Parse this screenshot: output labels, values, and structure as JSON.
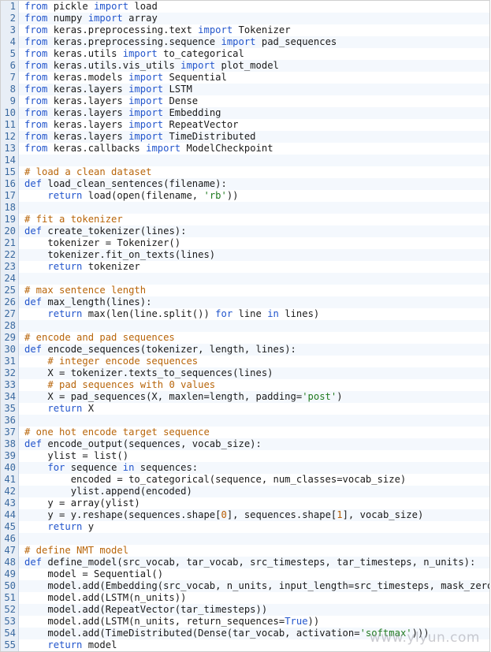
{
  "code": {
    "lines": [
      "from pickle import load",
      "from numpy import array",
      "from keras.preprocessing.text import Tokenizer",
      "from keras.preprocessing.sequence import pad_sequences",
      "from keras.utils import to_categorical",
      "from keras.utils.vis_utils import plot_model",
      "from keras.models import Sequential",
      "from keras.layers import LSTM",
      "from keras.layers import Dense",
      "from keras.layers import Embedding",
      "from keras.layers import RepeatVector",
      "from keras.layers import TimeDistributed",
      "from keras.callbacks import ModelCheckpoint",
      "",
      "# load a clean dataset",
      "def load_clean_sentences(filename):",
      "    return load(open(filename, 'rb'))",
      "",
      "# fit a tokenizer",
      "def create_tokenizer(lines):",
      "    tokenizer = Tokenizer()",
      "    tokenizer.fit_on_texts(lines)",
      "    return tokenizer",
      "",
      "# max sentence length",
      "def max_length(lines):",
      "    return max(len(line.split()) for line in lines)",
      "",
      "# encode and pad sequences",
      "def encode_sequences(tokenizer, length, lines):",
      "    # integer encode sequences",
      "    X = tokenizer.texts_to_sequences(lines)",
      "    # pad sequences with 0 values",
      "    X = pad_sequences(X, maxlen=length, padding='post')",
      "    return X",
      "",
      "# one hot encode target sequence",
      "def encode_output(sequences, vocab_size):",
      "    ylist = list()",
      "    for sequence in sequences:",
      "        encoded = to_categorical(sequence, num_classes=vocab_size)",
      "        ylist.append(encoded)",
      "    y = array(ylist)",
      "    y = y.reshape(sequences.shape[0], sequences.shape[1], vocab_size)",
      "    return y",
      "",
      "# define NMT model",
      "def define_model(src_vocab, tar_vocab, src_timesteps, tar_timesteps, n_units):",
      "    model = Sequential()",
      "    model.add(Embedding(src_vocab, n_units, input_length=src_timesteps, mask_zero=",
      "    model.add(LSTM(n_units))",
      "    model.add(RepeatVector(tar_timesteps))",
      "    model.add(LSTM(n_units, return_sequences=True))",
      "    model.add(TimeDistributed(Dense(tar_vocab, activation='softmax')))",
      "    return model"
    ]
  },
  "watermark": "www.ylyun.com",
  "colors": {
    "keyword": "#2255cc",
    "comment": "#b8650a",
    "string": "#1f7a1f",
    "line_number": "#3b6aa0"
  }
}
